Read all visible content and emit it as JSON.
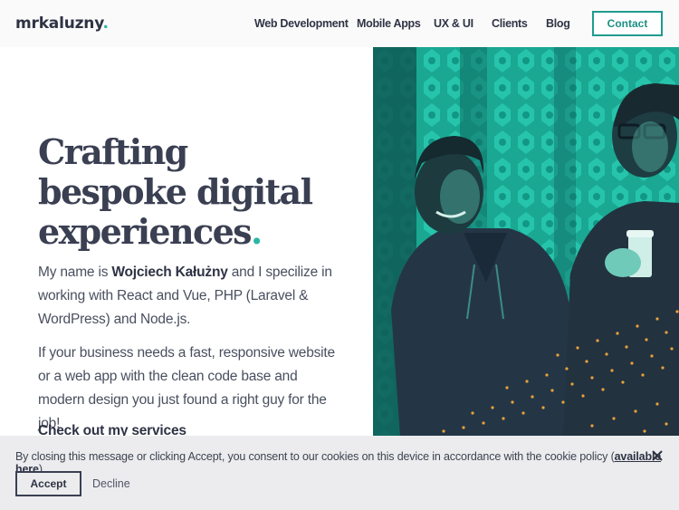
{
  "header": {
    "logo_text": "mrkaluzny",
    "logo_dot": ".",
    "nav": [
      {
        "label": "Web Development"
      },
      {
        "label": "Mobile Apps"
      },
      {
        "label": "UX & UI"
      },
      {
        "label": "Clients"
      },
      {
        "label": "Blog"
      }
    ],
    "contact_label": "Contact"
  },
  "hero": {
    "title_line1": "Crafting",
    "title_line2": "bespoke digital",
    "title_line3": "experiences",
    "title_dot": ".",
    "intro_prefix": "My name is ",
    "intro_name": "Wojciech Kałużny",
    "intro_suffix": " and I specilize in working with React and Vue, PHP (Laravel & WordPress) and Node.js.",
    "pitch": "If your business needs a fast, responsive website or a web app with the clean code base and modern design you just found a right guy for the job!",
    "services_link": "Check out my services"
  },
  "photo": {
    "alt": ""
  },
  "cookie": {
    "text_before": "By closing this message or clicking Accept, you consent to our cookies on this device in accordance with the cookie policy (",
    "link_label": "available here",
    "text_after": ").",
    "accept_label": "Accept",
    "decline_label": "Decline"
  },
  "colors": {
    "accent": "#27b6a4",
    "text_dark": "#2e3344",
    "banner_bg": "#ececee"
  }
}
